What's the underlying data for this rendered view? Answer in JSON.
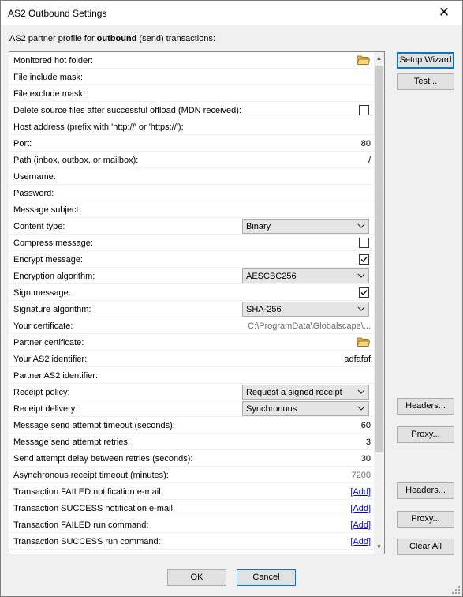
{
  "window": {
    "title": "AS2 Outbound Settings",
    "close_glyph": "✕"
  },
  "subtitle": {
    "prefix": "AS2 partner profile for ",
    "bold": "outbound",
    "suffix": " (send) transactions:"
  },
  "rows": [
    {
      "label": "Monitored hot folder:",
      "type": "folder",
      "icon": "folder-icon"
    },
    {
      "label": "File include mask:",
      "type": "text",
      "value": ""
    },
    {
      "label": "File exclude mask:",
      "type": "text",
      "value": ""
    },
    {
      "label": "Delete source files after successful offload (MDN received):",
      "type": "checkbox",
      "checked": false
    },
    {
      "label": "Host address (prefix with 'http://' or 'https://'):",
      "type": "text",
      "value": ""
    },
    {
      "label": "Port:",
      "type": "text",
      "value": "80"
    },
    {
      "label": "Path (inbox, outbox, or mailbox):",
      "type": "text",
      "value": "/"
    },
    {
      "label": "Username:",
      "type": "text",
      "value": ""
    },
    {
      "label": "Password:",
      "type": "text",
      "value": ""
    },
    {
      "label": "Message subject:",
      "type": "text",
      "value": ""
    },
    {
      "label": "Content type:",
      "type": "select",
      "value": "Binary"
    },
    {
      "label": "Compress message:",
      "type": "checkbox",
      "checked": false
    },
    {
      "label": "Encrypt message:",
      "type": "checkbox",
      "checked": true
    },
    {
      "label": "Encryption algorithm:",
      "type": "select",
      "value": "AESCBC256"
    },
    {
      "label": "Sign message:",
      "type": "checkbox",
      "checked": true
    },
    {
      "label": "Signature algorithm:",
      "type": "select",
      "value": "SHA-256"
    },
    {
      "label": "Your certificate:",
      "type": "gray",
      "value": "C:\\ProgramData\\Globalscape\\..."
    },
    {
      "label": "Partner certificate:",
      "type": "folder",
      "icon": "folder-icon"
    },
    {
      "label": "Your AS2 identifier:",
      "type": "text",
      "value": "adfafaf"
    },
    {
      "label": "Partner AS2 identifier:",
      "type": "text",
      "value": ""
    },
    {
      "label": "Receipt policy:",
      "type": "select",
      "value": "Request a signed receipt"
    },
    {
      "label": "Receipt delivery:",
      "type": "select",
      "value": "Synchronous"
    },
    {
      "label": "Message send attempt timeout (seconds):",
      "type": "text",
      "value": "60"
    },
    {
      "label": "Message send attempt retries:",
      "type": "text",
      "value": "3"
    },
    {
      "label": "Send attempt delay between retries (seconds):",
      "type": "text",
      "value": "30"
    },
    {
      "label": "Asynchronous receipt timeout (minutes):",
      "type": "gray",
      "value": "7200"
    },
    {
      "label": "Transaction FAILED notification e-mail:",
      "type": "link",
      "value": "[Add]"
    },
    {
      "label": "Transaction SUCCESS notification e-mail:",
      "type": "link",
      "value": "[Add]"
    },
    {
      "label": "Transaction FAILED run command:",
      "type": "link",
      "value": "[Add]"
    },
    {
      "label": "Transaction SUCCESS run command:",
      "type": "link",
      "value": "[Add]"
    }
  ],
  "buttons": {
    "setup_wizard": "Setup Wizard",
    "test": "Test...",
    "headers1": "Headers...",
    "proxy1": "Proxy...",
    "headers2": "Headers...",
    "proxy2": "Proxy...",
    "clear_all": "Clear All",
    "ok": "OK",
    "cancel": "Cancel"
  },
  "scrollbar": {
    "up_glyph": "▲",
    "down_glyph": "▼"
  },
  "colors": {
    "accent": "#0078d7",
    "link": "#0000ff",
    "folder": "#e8b84a"
  }
}
